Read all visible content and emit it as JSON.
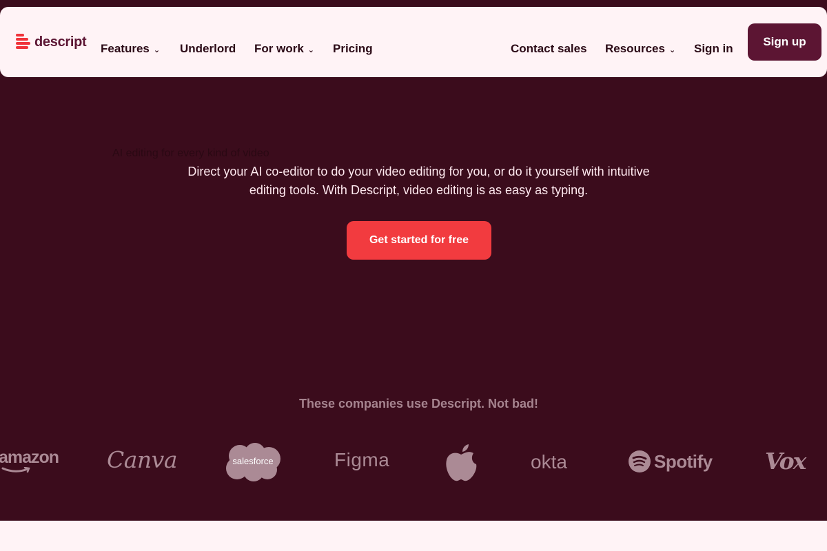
{
  "header": {
    "logo_text": "descript",
    "nav": {
      "features": "Features",
      "underlord": "Underlord",
      "for_work": "For work",
      "pricing": "Pricing",
      "contact_sales": "Contact sales",
      "resources": "Resources",
      "sign_in": "Sign in"
    },
    "signup_label": "Sign up"
  },
  "hero": {
    "ghost_text": "AI editing for every kind of video",
    "description": "Direct your AI co-editor to do your video editing for you, or do it yourself with intuitive editing tools. With Descript, video editing is as easy as typing.",
    "cta_label": "Get started for free"
  },
  "companies": {
    "title": "These companies use Descript. Not bad!",
    "logos": {
      "amazon": "amazon",
      "canva": "Canva",
      "salesforce": "salesforce",
      "figma": "Figma",
      "okta": "okta",
      "spotify": "Spotify",
      "vox": "Vox"
    }
  },
  "icons": {
    "logo": "descript-logo-icon",
    "chevron": "chevron-down-icon",
    "apple": "apple-logo-icon",
    "spotify": "spotify-logo-icon",
    "salesforce": "salesforce-cloud-icon"
  },
  "colors": {
    "background": "#3b0c1c",
    "header_bg": "#fff3f6",
    "brand": "#5c1533",
    "cta": "#f23b3f",
    "logo_gray": "#ab8a95"
  }
}
